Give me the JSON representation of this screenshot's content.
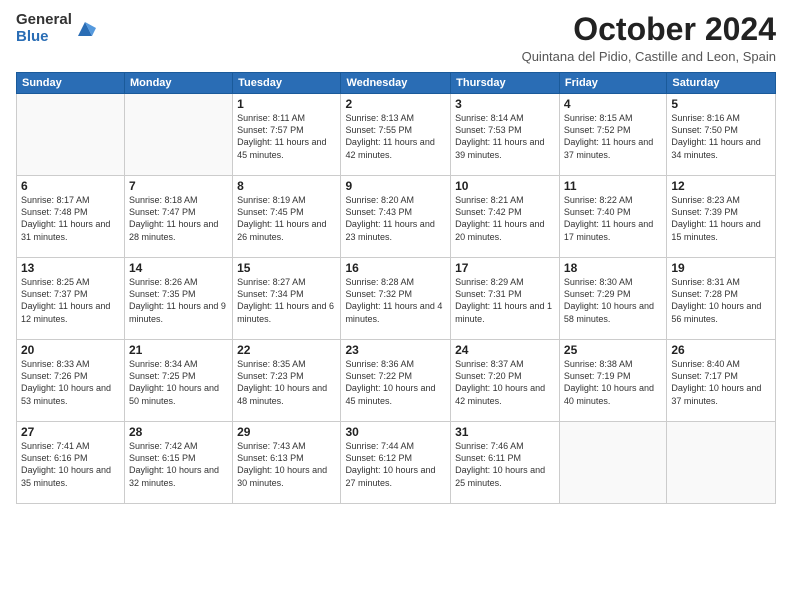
{
  "logo": {
    "general": "General",
    "blue": "Blue"
  },
  "header": {
    "month": "October 2024",
    "subtitle": "Quintana del Pidio, Castille and Leon, Spain"
  },
  "weekdays": [
    "Sunday",
    "Monday",
    "Tuesday",
    "Wednesday",
    "Thursday",
    "Friday",
    "Saturday"
  ],
  "weeks": [
    [
      {
        "day": "",
        "info": ""
      },
      {
        "day": "",
        "info": ""
      },
      {
        "day": "1",
        "info": "Sunrise: 8:11 AM\nSunset: 7:57 PM\nDaylight: 11 hours and 45 minutes."
      },
      {
        "day": "2",
        "info": "Sunrise: 8:13 AM\nSunset: 7:55 PM\nDaylight: 11 hours and 42 minutes."
      },
      {
        "day": "3",
        "info": "Sunrise: 8:14 AM\nSunset: 7:53 PM\nDaylight: 11 hours and 39 minutes."
      },
      {
        "day": "4",
        "info": "Sunrise: 8:15 AM\nSunset: 7:52 PM\nDaylight: 11 hours and 37 minutes."
      },
      {
        "day": "5",
        "info": "Sunrise: 8:16 AM\nSunset: 7:50 PM\nDaylight: 11 hours and 34 minutes."
      }
    ],
    [
      {
        "day": "6",
        "info": "Sunrise: 8:17 AM\nSunset: 7:48 PM\nDaylight: 11 hours and 31 minutes."
      },
      {
        "day": "7",
        "info": "Sunrise: 8:18 AM\nSunset: 7:47 PM\nDaylight: 11 hours and 28 minutes."
      },
      {
        "day": "8",
        "info": "Sunrise: 8:19 AM\nSunset: 7:45 PM\nDaylight: 11 hours and 26 minutes."
      },
      {
        "day": "9",
        "info": "Sunrise: 8:20 AM\nSunset: 7:43 PM\nDaylight: 11 hours and 23 minutes."
      },
      {
        "day": "10",
        "info": "Sunrise: 8:21 AM\nSunset: 7:42 PM\nDaylight: 11 hours and 20 minutes."
      },
      {
        "day": "11",
        "info": "Sunrise: 8:22 AM\nSunset: 7:40 PM\nDaylight: 11 hours and 17 minutes."
      },
      {
        "day": "12",
        "info": "Sunrise: 8:23 AM\nSunset: 7:39 PM\nDaylight: 11 hours and 15 minutes."
      }
    ],
    [
      {
        "day": "13",
        "info": "Sunrise: 8:25 AM\nSunset: 7:37 PM\nDaylight: 11 hours and 12 minutes."
      },
      {
        "day": "14",
        "info": "Sunrise: 8:26 AM\nSunset: 7:35 PM\nDaylight: 11 hours and 9 minutes."
      },
      {
        "day": "15",
        "info": "Sunrise: 8:27 AM\nSunset: 7:34 PM\nDaylight: 11 hours and 6 minutes."
      },
      {
        "day": "16",
        "info": "Sunrise: 8:28 AM\nSunset: 7:32 PM\nDaylight: 11 hours and 4 minutes."
      },
      {
        "day": "17",
        "info": "Sunrise: 8:29 AM\nSunset: 7:31 PM\nDaylight: 11 hours and 1 minute."
      },
      {
        "day": "18",
        "info": "Sunrise: 8:30 AM\nSunset: 7:29 PM\nDaylight: 10 hours and 58 minutes."
      },
      {
        "day": "19",
        "info": "Sunrise: 8:31 AM\nSunset: 7:28 PM\nDaylight: 10 hours and 56 minutes."
      }
    ],
    [
      {
        "day": "20",
        "info": "Sunrise: 8:33 AM\nSunset: 7:26 PM\nDaylight: 10 hours and 53 minutes."
      },
      {
        "day": "21",
        "info": "Sunrise: 8:34 AM\nSunset: 7:25 PM\nDaylight: 10 hours and 50 minutes."
      },
      {
        "day": "22",
        "info": "Sunrise: 8:35 AM\nSunset: 7:23 PM\nDaylight: 10 hours and 48 minutes."
      },
      {
        "day": "23",
        "info": "Sunrise: 8:36 AM\nSunset: 7:22 PM\nDaylight: 10 hours and 45 minutes."
      },
      {
        "day": "24",
        "info": "Sunrise: 8:37 AM\nSunset: 7:20 PM\nDaylight: 10 hours and 42 minutes."
      },
      {
        "day": "25",
        "info": "Sunrise: 8:38 AM\nSunset: 7:19 PM\nDaylight: 10 hours and 40 minutes."
      },
      {
        "day": "26",
        "info": "Sunrise: 8:40 AM\nSunset: 7:17 PM\nDaylight: 10 hours and 37 minutes."
      }
    ],
    [
      {
        "day": "27",
        "info": "Sunrise: 7:41 AM\nSunset: 6:16 PM\nDaylight: 10 hours and 35 minutes."
      },
      {
        "day": "28",
        "info": "Sunrise: 7:42 AM\nSunset: 6:15 PM\nDaylight: 10 hours and 32 minutes."
      },
      {
        "day": "29",
        "info": "Sunrise: 7:43 AM\nSunset: 6:13 PM\nDaylight: 10 hours and 30 minutes."
      },
      {
        "day": "30",
        "info": "Sunrise: 7:44 AM\nSunset: 6:12 PM\nDaylight: 10 hours and 27 minutes."
      },
      {
        "day": "31",
        "info": "Sunrise: 7:46 AM\nSunset: 6:11 PM\nDaylight: 10 hours and 25 minutes."
      },
      {
        "day": "",
        "info": ""
      },
      {
        "day": "",
        "info": ""
      }
    ]
  ]
}
